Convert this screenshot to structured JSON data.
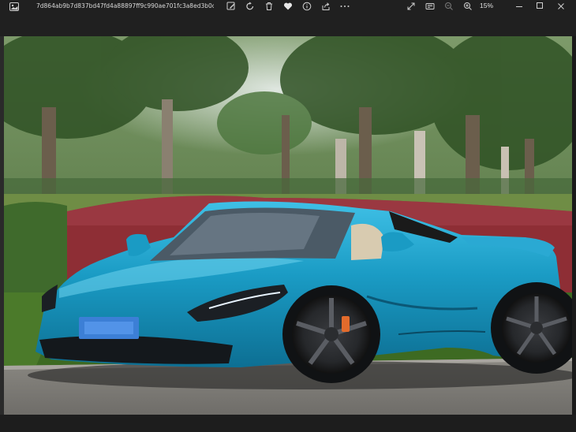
{
  "window": {
    "filename": "7d864ab9b7d837bd47fd4a88897ff9c990ae701fc3a8ed3b0c05ce2c...",
    "zoom": "15%"
  },
  "toolbar": {
    "icons": [
      "photo-app-icon",
      "edit-image-icon",
      "rotate-icon",
      "delete-icon",
      "favorite-icon",
      "info-icon",
      "share-icon",
      "more-icon"
    ],
    "right_icons": [
      "fullscreen-icon",
      "slideshow-icon",
      "zoom-out-icon",
      "zoom-in-icon"
    ],
    "window_controls": [
      "minimize-icon",
      "maximize-icon",
      "close-icon"
    ]
  },
  "colors": {
    "chrome_bg": "#202020",
    "car_body": "#1a9bc4",
    "hedge_red": "#8e2e35",
    "hedge_green": "#3f6a2c",
    "trees": "#345a2a"
  }
}
